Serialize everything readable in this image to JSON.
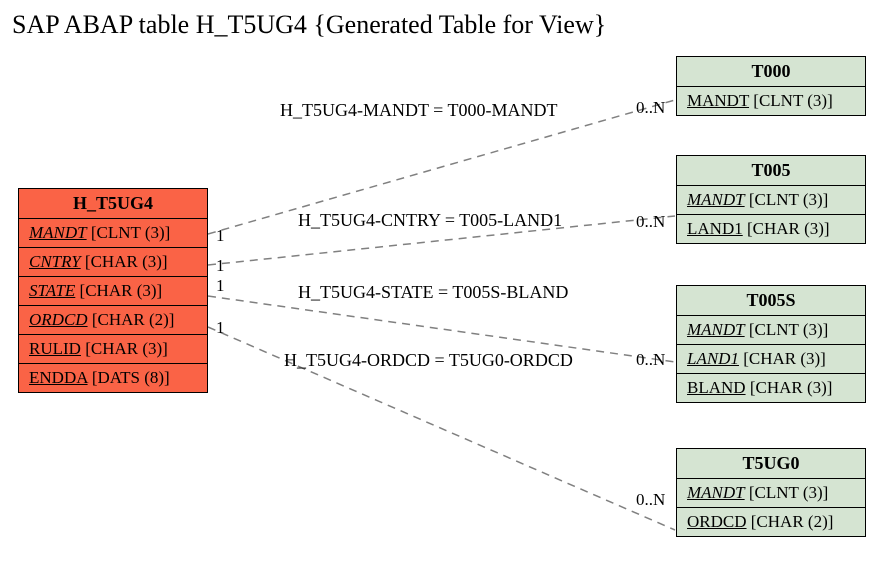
{
  "title": "SAP ABAP table H_T5UG4 {Generated Table for View}",
  "source": {
    "name": "H_T5UG4",
    "fields": [
      {
        "name": "MANDT",
        "type": "[CLNT (3)]",
        "key": true
      },
      {
        "name": "CNTRY",
        "type": "[CHAR (3)]",
        "key": true
      },
      {
        "name": "STATE",
        "type": "[CHAR (3)]",
        "key": true
      },
      {
        "name": "ORDCD",
        "type": "[CHAR (2)]",
        "key": true
      },
      {
        "name": "RULID",
        "type": "[CHAR (3)]",
        "key": false
      },
      {
        "name": "ENDDA",
        "type": "[DATS (8)]",
        "key": false
      }
    ]
  },
  "targets": [
    {
      "name": "T000",
      "fields": [
        {
          "name": "MANDT",
          "type": "[CLNT (3)]",
          "key": false
        }
      ]
    },
    {
      "name": "T005",
      "fields": [
        {
          "name": "MANDT",
          "type": "[CLNT (3)]",
          "key": true
        },
        {
          "name": "LAND1",
          "type": "[CHAR (3)]",
          "key": false
        }
      ]
    },
    {
      "name": "T005S",
      "fields": [
        {
          "name": "MANDT",
          "type": "[CLNT (3)]",
          "key": true
        },
        {
          "name": "LAND1",
          "type": "[CHAR (3)]",
          "key": true
        },
        {
          "name": "BLAND",
          "type": "[CHAR (3)]",
          "key": false
        }
      ]
    },
    {
      "name": "T5UG0",
      "fields": [
        {
          "name": "MANDT",
          "type": "[CLNT (3)]",
          "key": true
        },
        {
          "name": "ORDCD",
          "type": "[CHAR (2)]",
          "key": false
        }
      ]
    }
  ],
  "relations": [
    {
      "label": "H_T5UG4-MANDT = T000-MANDT",
      "left_card": "1",
      "right_card": "0..N"
    },
    {
      "label": "H_T5UG4-CNTRY = T005-LAND1",
      "left_card": "1",
      "right_card": "0..N"
    },
    {
      "label": "H_T5UG4-STATE = T005S-BLAND",
      "left_card": "1",
      "right_card": ""
    },
    {
      "label": "H_T5UG4-ORDCD = T5UG0-ORDCD",
      "left_card": "1",
      "right_card": "0..N"
    }
  ],
  "extra_cards": {
    "t5ug0_right": "0..N"
  }
}
